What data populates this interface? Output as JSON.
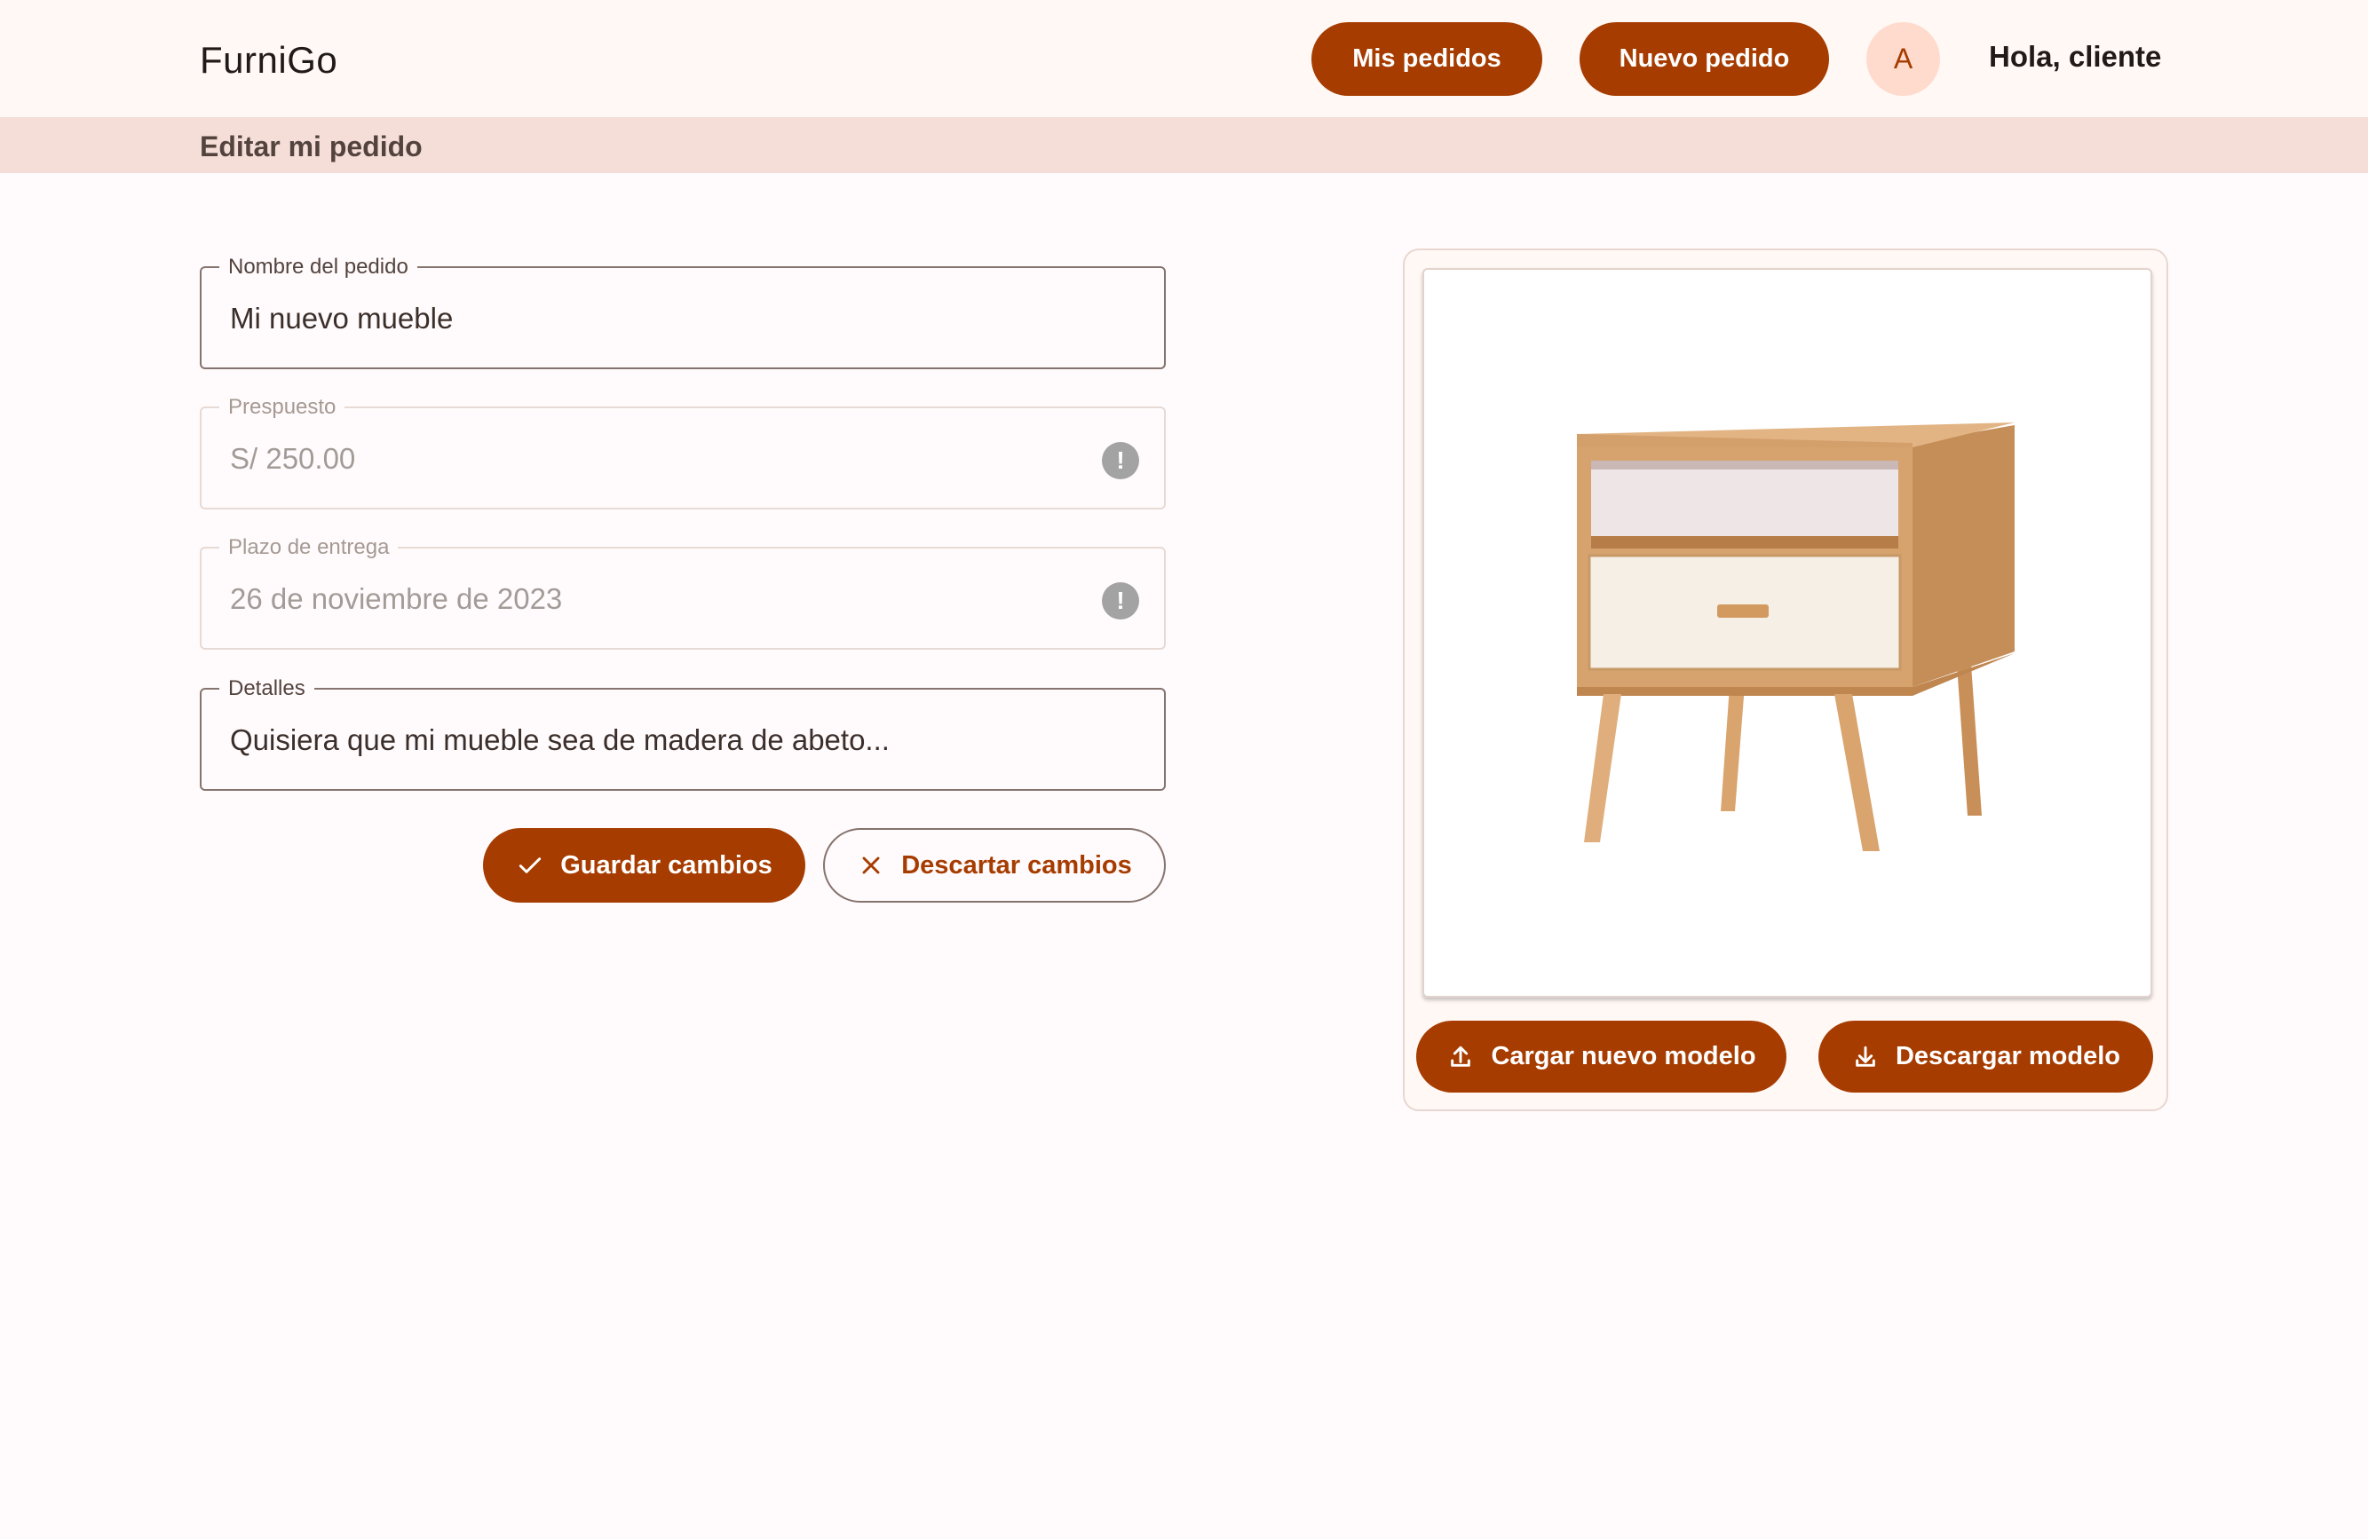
{
  "app": {
    "brand": "FurniGo"
  },
  "header": {
    "orders_label": "Mis pedidos",
    "new_order_label": "Nuevo pedido",
    "avatar_initial": "A",
    "greeting": "Hola, cliente"
  },
  "subheader": {
    "title": "Editar mi pedido"
  },
  "form": {
    "name": {
      "label": "Nombre del pedido",
      "value": "Mi nuevo mueble"
    },
    "budget": {
      "label": "Prespuesto",
      "value": "S/ 250.00",
      "icon": "alert-icon"
    },
    "deadline": {
      "label": "Plazo de entrega",
      "value": "26 de noviembre de 2023",
      "icon": "alert-icon"
    },
    "details": {
      "label": "Detalles",
      "value": "Quisiera que mi mueble sea de madera de abeto..."
    },
    "save_label": "Guardar cambios",
    "discard_label": "Descartar cambios"
  },
  "model": {
    "upload_label": "Cargar nuevo modelo",
    "download_label": "Descargar modelo"
  },
  "colors": {
    "primary": "#a63c00",
    "avatar_bg": "#ffdbcd",
    "subbar_bg": "#f5ded7",
    "topbar_bg": "#fff8f5"
  }
}
